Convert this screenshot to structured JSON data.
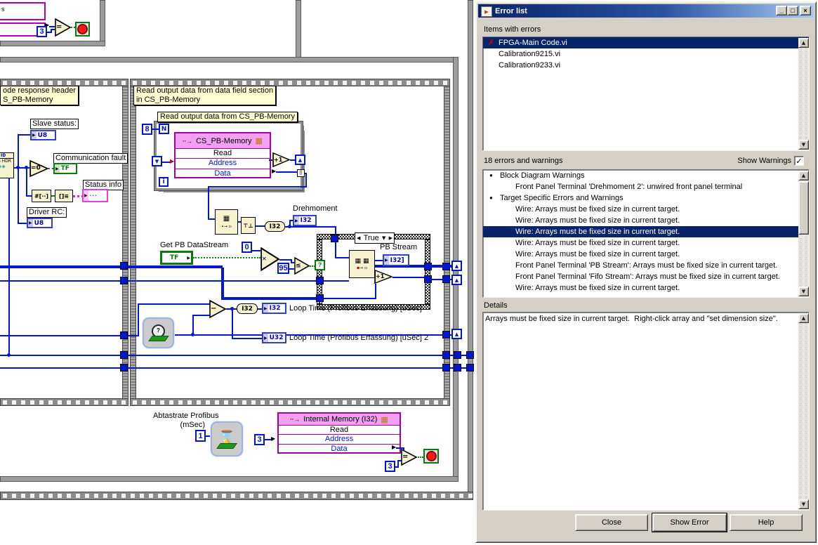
{
  "dialog": {
    "title": "Error list",
    "items_header": "Items with errors",
    "items": [
      {
        "text": "FPGA-Main Code.vi",
        "selected": true,
        "error": true
      },
      {
        "text": "Calibration9215.vi",
        "selected": false,
        "error": false
      },
      {
        "text": "Calibration9233.vi",
        "selected": false,
        "error": false
      }
    ],
    "errors_header": "18 errors and warnings",
    "show_warnings_label": "Show Warnings",
    "error_rows": [
      {
        "text": "Block Diagram Warnings",
        "style": "bullet",
        "selected": false
      },
      {
        "text": "Front Panel Terminal 'Drehmoment 2': unwired front panel terminal",
        "style": "indent",
        "selected": false
      },
      {
        "text": "Target Specific Errors and Warnings",
        "style": "bullet",
        "selected": false
      },
      {
        "text": "Wire: Arrays must be fixed size in current target.",
        "style": "indent",
        "selected": false
      },
      {
        "text": "Wire: Arrays must be fixed size in current target.",
        "style": "indent",
        "selected": false
      },
      {
        "text": "Wire: Arrays must be fixed size in current target.",
        "style": "indent",
        "selected": true
      },
      {
        "text": "Wire: Arrays must be fixed size in current target.",
        "style": "indent",
        "selected": false
      },
      {
        "text": "Wire: Arrays must be fixed size in current target.",
        "style": "indent",
        "selected": false
      },
      {
        "text": "Front Panel Terminal 'PB Stream': Arrays must be fixed size in current target.",
        "style": "indent",
        "selected": false
      },
      {
        "text": "Front Panel Terminal 'Fifo Stream': Arrays must be fixed size in current target.",
        "style": "indent",
        "selected": false
      },
      {
        "text": "Wire: Arrays must be fixed size in current target.",
        "style": "indent",
        "selected": false
      }
    ],
    "details_header": "Details",
    "details_text": "Arrays must be fixed size in current target.  Right-click array and \"set dimension size\".",
    "buttons": {
      "close": "Close",
      "show_error": "Show Error",
      "help": "Help"
    }
  },
  "icons": {
    "bullet": "●",
    "error_x": "✗",
    "check": "✓",
    "up_arrow": "▲",
    "down_arrow": "▼",
    "left_arrow": "◀",
    "right_arrow": "▶",
    "minimize": "_",
    "maximize": "□",
    "close": "×",
    "mem_grid": "▦",
    "mem_write": "∙∙→",
    "hourglass": "⌛",
    "labview_arrow": "▶",
    "array_grid": "▦",
    "question": "?"
  },
  "diagram": {
    "labels": {
      "decode_header_l1": "ode response header",
      "decode_header_l2": "S_PB-Memory",
      "read_field_l1": "Read output data from data field section",
      "read_field_l2": "in CS_PB-Memory",
      "read_cspb": "Read output data from CS_PB-Memory",
      "slave_status": "Slave status:",
      "communication_fault": "Communication fault",
      "status_info": "Status info",
      "driver_rc": "Driver RC:",
      "drehmoment": "Drehmoment",
      "get_pb_datastream": "Get PB DataStream",
      "pb_stream": "PB Stream",
      "loop_time_1": "Loop Time (Profibus Erfassung) [uSec]",
      "loop_time_2": "Loop Time (Profibus Erfassung) [uSec] 2",
      "abtastrate_l1": "Abtastrate Profibus",
      "abtastrate_l2": "(mSec)"
    },
    "terminals": {
      "u8": "U8",
      "tf": "TF",
      "i32": "I32",
      "u32": "U32",
      "i32_array": "I32]",
      "n": "N",
      "i": "i",
      "q": "?",
      "s": "s",
      "true_case": "True",
      "subvi_l1": "ID",
      "subvi_l2": "S HDR",
      "status_glyph": "···"
    },
    "nodes": {
      "eq": "=",
      "eq0": "=0",
      "le": "≤",
      "minus": "−",
      "plus1": "+1",
      "select_glyph": "✕",
      "join_glyph": "⊤⊥",
      "num_to_bool_array": "#[··]",
      "bool_array_to_num": "[]≡",
      "i32_conv": "I32",
      "tunnel_idx": "[]",
      "cs_pb_memory": "CS_PB-Memory",
      "internal_memory": "Internal Memory (I32)",
      "mem_rows": [
        "Read",
        "Address",
        "Data"
      ]
    },
    "constants": {
      "three": "3",
      "eight": "8",
      "zero": "0",
      "ninetyfive": "95",
      "one": "1"
    }
  }
}
